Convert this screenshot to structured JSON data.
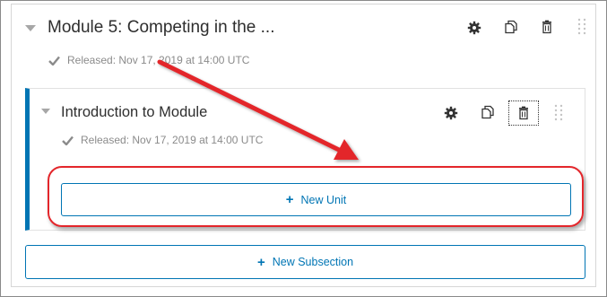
{
  "module": {
    "title": "Module 5: Competing in the ...",
    "released": "Released: Nov 17, 2019 at 14:00 UTC"
  },
  "subsection": {
    "title": "Introduction to Module",
    "released": "Released: Nov 17, 2019 at 14:00 UTC"
  },
  "buttons": {
    "new_unit": "New Unit",
    "new_subsection": "New Subsection"
  },
  "icons": [
    "settings-gear-icon",
    "duplicate-icon",
    "delete-trash-icon",
    "drag-handle-icon",
    "collapse-caret-icon",
    "check-icon"
  ],
  "colors": {
    "accent": "#0075b4",
    "annotation_red": "#e3262b",
    "muted_text": "#8b8b8b"
  }
}
